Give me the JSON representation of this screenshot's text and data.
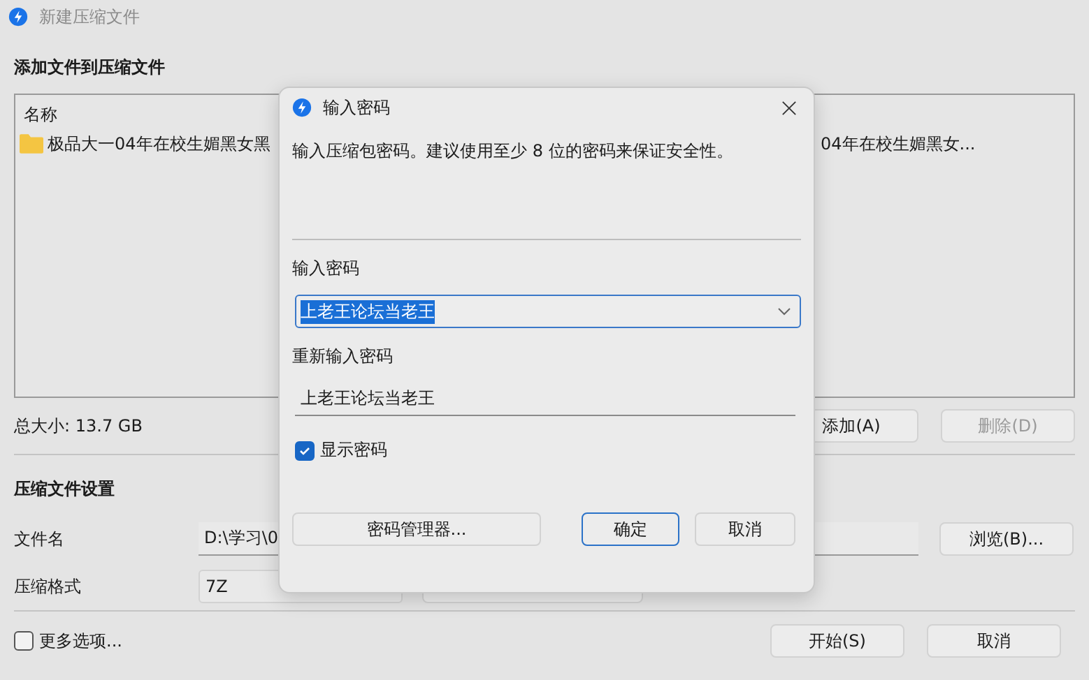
{
  "window": {
    "title": "新建压缩文件"
  },
  "files_section": {
    "heading": "添加文件到压缩文件",
    "columns": [
      "名称"
    ],
    "rows": [
      {
        "name": "极品大一04年在校生媚黑女黑",
        "column_2": "04年在校生媚黑女..."
      }
    ],
    "total_size": "总大小: 13.7 GB",
    "buttons": [
      {
        "label": "添加(A)",
        "disabled": false
      },
      {
        "label": "删除(D)",
        "disabled": true
      }
    ]
  },
  "settings": {
    "heading": "压缩文件设置",
    "filename_label": "文件名",
    "filename_value": "D:\\学习\\0",
    "browse_button": "浏览(B)...",
    "format_label": "压缩格式",
    "format_value": "7Z"
  },
  "more_options": {
    "label": "更多选项...",
    "checked": false
  },
  "footer_buttons": [
    "开始(S)",
    "取消"
  ],
  "dialog": {
    "title": "输入密码",
    "description": "输入压缩包密码。建议使用至少 8 位的密码来保证安全性。",
    "password_label": "输入密码",
    "password_value": "上老王论坛当老王",
    "confirm_label": "重新输入密码",
    "confirm_value": "上老王论坛当老王",
    "show_password": {
      "label": "显示密码",
      "checked": true
    },
    "buttons": [
      {
        "label": "密码管理器...",
        "default": false
      },
      {
        "label": "确定",
        "default": true
      },
      {
        "label": "取消",
        "default": false
      }
    ]
  }
}
